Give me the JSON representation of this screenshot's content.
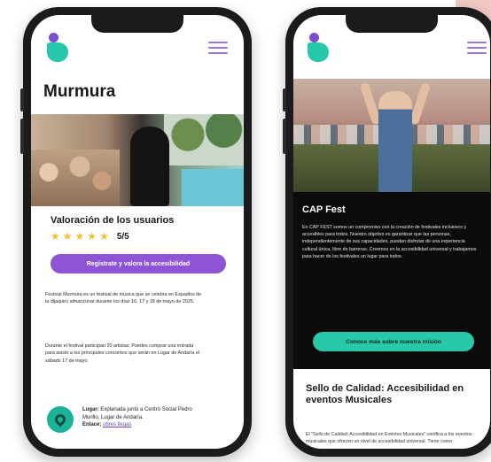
{
  "colors": {
    "accent_purple": "#8f54d6",
    "accent_teal": "#27c9a8",
    "star_yellow": "#f2c230",
    "phone_frame": "#1b1b1d"
  },
  "phone1": {
    "logo": "murmura-logo",
    "menu_icon": "hamburger-menu-icon",
    "title": "Murmura",
    "rating": {
      "title": "Valoración de los usuarios",
      "stars": 5,
      "score": "5/5"
    },
    "cta_label": "Regístrate y valora la accesibilidad",
    "paragraphs": [
      "Festival Murmura es un festival de música que se celebra en Espadlos de la dljaquiru almanzunar durante los días 16, 17 y 18 de mayo de 2025.",
      "Durante el festival participan 20 artistas. Puedes comprar una entrada para asistir a los principales conciertos que serán en Lugar de Andaría el sábado 17 de mayo."
    ],
    "location": {
      "icon": "map-pin-icon",
      "place_label": "Lugar:",
      "place_value": "Explanada junto a Centro Social Pedro Murillo, Lugar de Andaría.",
      "link_label": "Enlace:",
      "link_value": "ubres llegas"
    }
  },
  "phone2": {
    "logo": "brand-logo",
    "menu_icon": "hamburger-menu-icon",
    "section_title": "CAP Fest",
    "section_text": "En CAP FEST somos un compromiso con la creación de festivales inclusivos y accesibles para todos. Nuestro objetivo es garantizar que las personas, independientemente de sus capacidades, puedan disfrutar de una experiencia cultural única, libre de barreras. Creemos en la accesibilidad universal y trabajamos para hacer de los festivales un lugar para todos.",
    "cta_label": "Conoce más sobre nuestra misión",
    "seal_title": "Sello de Calidad: Accesibilidad en eventos Musicales",
    "seal_text": "El \"Sello de Calidad: Accesibilidad en Eventos Musicales\" certifica a los eventos musicales que ofrecen un nivel de accesibilidad universal. Tiene como"
  }
}
